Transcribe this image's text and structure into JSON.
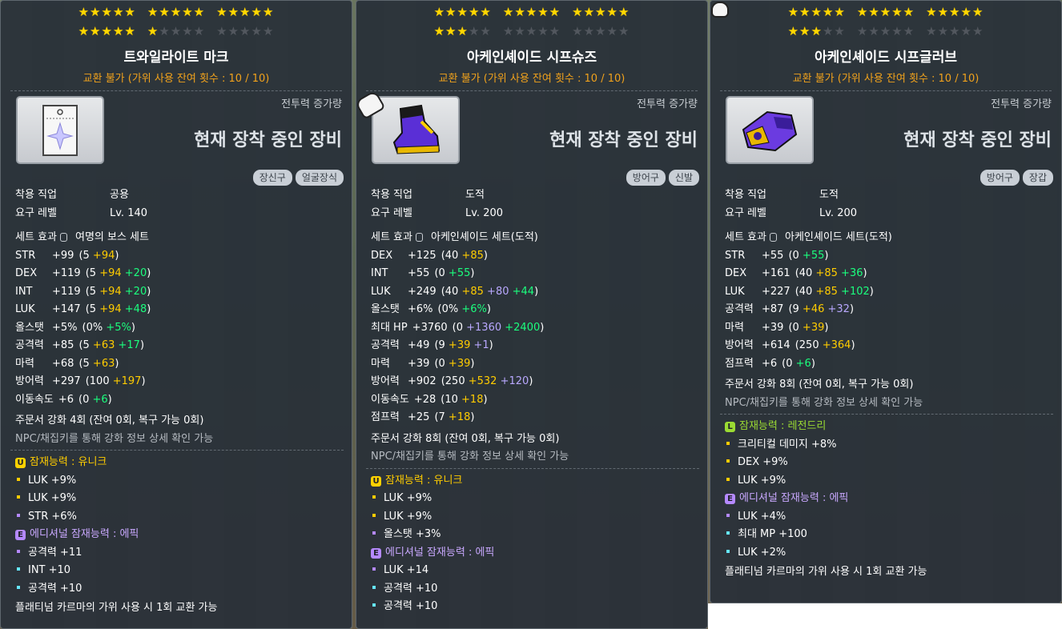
{
  "tooltips": [
    {
      "stars_row1": [
        true,
        true,
        true,
        true,
        true,
        true,
        true,
        true,
        true,
        true,
        true,
        true,
        true,
        true,
        true
      ],
      "stars_row2": [
        true,
        true,
        true,
        true,
        true,
        true,
        false,
        false,
        false,
        false,
        false,
        false,
        false,
        false,
        false
      ],
      "name": "트와일라이트 마크",
      "trade": "교환 불가 (가위 사용 잔여 횟수 : 10 / 10)",
      "cp_label": "전투력 증가량",
      "equipped_label": "현재 장착 중인 장비",
      "icon": "twilight-mark-icon",
      "tags": [
        "장신구",
        "얼굴장식"
      ],
      "job_label": "착용 직업",
      "job": "공용",
      "level_label": "요구 레벨",
      "level": "Lv. 140",
      "set_label": "세트 효과",
      "set_name": "여명의 보스 세트",
      "stats": [
        {
          "name": "STR",
          "total": "+99",
          "parts": [
            {
              "t": "(5 ",
              "c": ""
            },
            {
              "t": "+94",
              "c": "y"
            },
            {
              "t": ")",
              "c": ""
            }
          ]
        },
        {
          "name": "DEX",
          "total": "+119",
          "parts": [
            {
              "t": "(5 ",
              "c": ""
            },
            {
              "t": "+94",
              "c": "y"
            },
            {
              "t": " ",
              "c": ""
            },
            {
              "t": "+20",
              "c": "g"
            },
            {
              "t": ")",
              "c": ""
            }
          ]
        },
        {
          "name": "INT",
          "total": "+119",
          "parts": [
            {
              "t": "(5 ",
              "c": ""
            },
            {
              "t": "+94",
              "c": "y"
            },
            {
              "t": " ",
              "c": ""
            },
            {
              "t": "+20",
              "c": "g"
            },
            {
              "t": ")",
              "c": ""
            }
          ]
        },
        {
          "name": "LUK",
          "total": "+147",
          "parts": [
            {
              "t": "(5 ",
              "c": ""
            },
            {
              "t": "+94",
              "c": "y"
            },
            {
              "t": " ",
              "c": ""
            },
            {
              "t": "+48",
              "c": "g"
            },
            {
              "t": ")",
              "c": ""
            }
          ]
        },
        {
          "name": "올스탯",
          "total": "+5%",
          "parts": [
            {
              "t": "(0% ",
              "c": ""
            },
            {
              "t": "+5%",
              "c": "g"
            },
            {
              "t": ")",
              "c": ""
            }
          ]
        },
        {
          "name": "공격력",
          "total": "+85",
          "parts": [
            {
              "t": "(5 ",
              "c": ""
            },
            {
              "t": "+63",
              "c": "y"
            },
            {
              "t": " ",
              "c": ""
            },
            {
              "t": "+17",
              "c": "g"
            },
            {
              "t": ")",
              "c": ""
            }
          ]
        },
        {
          "name": "마력",
          "total": "+68",
          "parts": [
            {
              "t": "(5 ",
              "c": ""
            },
            {
              "t": "+63",
              "c": "y"
            },
            {
              "t": ")",
              "c": ""
            }
          ]
        },
        {
          "name": "방어력",
          "total": "+297",
          "parts": [
            {
              "t": "(100 ",
              "c": ""
            },
            {
              "t": "+197",
              "c": "y"
            },
            {
              "t": ")",
              "c": ""
            }
          ]
        },
        {
          "name": "이동속도",
          "total": "+6",
          "parts": [
            {
              "t": "(0 ",
              "c": ""
            },
            {
              "t": "+6",
              "c": "g"
            },
            {
              "t": ")",
              "c": ""
            }
          ]
        }
      ],
      "enhance": "주문서 강화 4회 (잔여 0회, 복구 가능 0회)",
      "enhance_hint": "NPC/채집키를 통해 강화 정보 상세 확인 가능",
      "potential": {
        "badge": "U",
        "grade": "u",
        "title": "잠재능력 : 유니크",
        "lines": [
          "LUK +9%",
          "LUK +9%",
          "STR +6%"
        ],
        "colors": [
          "u",
          "u",
          "e"
        ]
      },
      "additional": {
        "badge": "E",
        "grade": "e",
        "title": "에디셔널 잠재능력 : 에픽",
        "lines": [
          "공격력 +11",
          "INT +10",
          "공격력 +10"
        ],
        "colors": [
          "e",
          "c",
          "c"
        ]
      },
      "footer": "플래티넘 카르마의 가위 사용 시 1회 교환 가능"
    },
    {
      "stars_row1": [
        true,
        true,
        true,
        true,
        true,
        true,
        true,
        true,
        true,
        true,
        true,
        true,
        true,
        true,
        true
      ],
      "stars_row2": [
        true,
        true,
        true,
        false,
        false,
        false,
        false,
        false,
        false,
        false,
        false,
        false,
        false,
        false,
        false
      ],
      "name": "아케인셰이드 시프슈즈",
      "trade": "교환 불가 (가위 사용 잔여 횟수 : 10 / 10)",
      "cp_label": "전투력 증가량",
      "equipped_label": "현재 장착 중인 장비",
      "icon": "arcane-shoes-icon",
      "tags": [
        "방어구",
        "신발"
      ],
      "job_label": "착용 직업",
      "job": "도적",
      "level_label": "요구 레벨",
      "level": "Lv. 200",
      "set_label": "세트 효과",
      "set_name": "아케인셰이드 세트(도적)",
      "stats": [
        {
          "name": "DEX",
          "total": "+125",
          "parts": [
            {
              "t": "(40 ",
              "c": ""
            },
            {
              "t": "+85",
              "c": "y"
            },
            {
              "t": ")",
              "c": ""
            }
          ]
        },
        {
          "name": "INT",
          "total": "+55",
          "parts": [
            {
              "t": "(0 ",
              "c": ""
            },
            {
              "t": "+55",
              "c": "g"
            },
            {
              "t": ")",
              "c": ""
            }
          ]
        },
        {
          "name": "LUK",
          "total": "+249",
          "parts": [
            {
              "t": "(40 ",
              "c": ""
            },
            {
              "t": "+85",
              "c": "y"
            },
            {
              "t": " ",
              "c": ""
            },
            {
              "t": "+80",
              "c": "p"
            },
            {
              "t": " ",
              "c": ""
            },
            {
              "t": "+44",
              "c": "g"
            },
            {
              "t": ")",
              "c": ""
            }
          ]
        },
        {
          "name": "올스탯",
          "total": "+6%",
          "parts": [
            {
              "t": "(0% ",
              "c": ""
            },
            {
              "t": "+6%",
              "c": "g"
            },
            {
              "t": ")",
              "c": ""
            }
          ]
        },
        {
          "name": "최대 HP",
          "total": "+3760",
          "parts": [
            {
              "t": "(0 ",
              "c": ""
            },
            {
              "t": "+1360",
              "c": "p"
            },
            {
              "t": " ",
              "c": ""
            },
            {
              "t": "+2400",
              "c": "g"
            },
            {
              "t": ")",
              "c": ""
            }
          ]
        },
        {
          "name": "공격력",
          "total": "+49",
          "parts": [
            {
              "t": "(9 ",
              "c": ""
            },
            {
              "t": "+39",
              "c": "y"
            },
            {
              "t": " ",
              "c": ""
            },
            {
              "t": "+1",
              "c": "p"
            },
            {
              "t": ")",
              "c": ""
            }
          ]
        },
        {
          "name": "마력",
          "total": "+39",
          "parts": [
            {
              "t": "(0 ",
              "c": ""
            },
            {
              "t": "+39",
              "c": "y"
            },
            {
              "t": ")",
              "c": ""
            }
          ]
        },
        {
          "name": "방어력",
          "total": "+902",
          "parts": [
            {
              "t": "(250 ",
              "c": ""
            },
            {
              "t": "+532",
              "c": "y"
            },
            {
              "t": " ",
              "c": ""
            },
            {
              "t": "+120",
              "c": "p"
            },
            {
              "t": ")",
              "c": ""
            }
          ]
        },
        {
          "name": "이동속도",
          "total": "+28",
          "parts": [
            {
              "t": "(10 ",
              "c": ""
            },
            {
              "t": "+18",
              "c": "y"
            },
            {
              "t": ")",
              "c": ""
            }
          ]
        },
        {
          "name": "점프력",
          "total": "+25",
          "parts": [
            {
              "t": "(7 ",
              "c": ""
            },
            {
              "t": "+18",
              "c": "y"
            },
            {
              "t": ")",
              "c": ""
            }
          ]
        }
      ],
      "enhance": "주문서 강화 8회 (잔여 0회, 복구 가능 0회)",
      "enhance_hint": "NPC/채집키를 통해 강화 정보 상세 확인 가능",
      "potential": {
        "badge": "U",
        "grade": "u",
        "title": "잠재능력 : 유니크",
        "lines": [
          "LUK +9%",
          "LUK +9%",
          "올스탯 +3%"
        ],
        "colors": [
          "u",
          "u",
          "e"
        ]
      },
      "additional": {
        "badge": "E",
        "grade": "e",
        "title": "에디셔널 잠재능력 : 에픽",
        "lines": [
          "LUK +14",
          "공격력 +10",
          "공격력 +10"
        ],
        "colors": [
          "e",
          "c",
          "c"
        ]
      },
      "footer": ""
    },
    {
      "stars_row1": [
        true,
        true,
        true,
        true,
        true,
        true,
        true,
        true,
        true,
        true,
        true,
        true,
        true,
        true,
        true
      ],
      "stars_row2": [
        true,
        true,
        true,
        false,
        false,
        false,
        false,
        false,
        false,
        false,
        false,
        false,
        false,
        false,
        false
      ],
      "name": "아케인셰이드 시프글러브",
      "trade": "교환 불가 (가위 사용 잔여 횟수 : 10 / 10)",
      "cp_label": "전투력 증가량",
      "equipped_label": "현재 장착 중인 장비",
      "icon": "arcane-glove-icon",
      "tags": [
        "방어구",
        "장갑"
      ],
      "job_label": "착용 직업",
      "job": "도적",
      "level_label": "요구 레벨",
      "level": "Lv. 200",
      "set_label": "세트 효과",
      "set_name": "아케인셰이드 세트(도적)",
      "stats": [
        {
          "name": "STR",
          "total": "+55",
          "parts": [
            {
              "t": "(0 ",
              "c": ""
            },
            {
              "t": "+55",
              "c": "g"
            },
            {
              "t": ")",
              "c": ""
            }
          ]
        },
        {
          "name": "DEX",
          "total": "+161",
          "parts": [
            {
              "t": "(40 ",
              "c": ""
            },
            {
              "t": "+85",
              "c": "y"
            },
            {
              "t": " ",
              "c": ""
            },
            {
              "t": "+36",
              "c": "g"
            },
            {
              "t": ")",
              "c": ""
            }
          ]
        },
        {
          "name": "LUK",
          "total": "+227",
          "parts": [
            {
              "t": "(40 ",
              "c": ""
            },
            {
              "t": "+85",
              "c": "y"
            },
            {
              "t": " ",
              "c": ""
            },
            {
              "t": "+102",
              "c": "g"
            },
            {
              "t": ")",
              "c": ""
            }
          ]
        },
        {
          "name": "공격력",
          "total": "+87",
          "parts": [
            {
              "t": "(9 ",
              "c": ""
            },
            {
              "t": "+46",
              "c": "y"
            },
            {
              "t": " ",
              "c": ""
            },
            {
              "t": "+32",
              "c": "p"
            },
            {
              "t": ")",
              "c": ""
            }
          ]
        },
        {
          "name": "마력",
          "total": "+39",
          "parts": [
            {
              "t": "(0 ",
              "c": ""
            },
            {
              "t": "+39",
              "c": "y"
            },
            {
              "t": ")",
              "c": ""
            }
          ]
        },
        {
          "name": "방어력",
          "total": "+614",
          "parts": [
            {
              "t": "(250 ",
              "c": ""
            },
            {
              "t": "+364",
              "c": "y"
            },
            {
              "t": ")",
              "c": ""
            }
          ]
        },
        {
          "name": "점프력",
          "total": "+6",
          "parts": [
            {
              "t": "(0 ",
              "c": ""
            },
            {
              "t": "+6",
              "c": "g"
            },
            {
              "t": ")",
              "c": ""
            }
          ]
        }
      ],
      "enhance": "주문서 강화 8회 (잔여 0회, 복구 가능 0회)",
      "enhance_hint": "NPC/채집키를 통해 강화 정보 상세 확인 가능",
      "potential": {
        "badge": "L",
        "grade": "l",
        "title": "잠재능력 : 레전드리",
        "lines": [
          "크리티컬 데미지 +8%",
          "DEX +9%",
          "LUK +9%"
        ],
        "colors": [
          "l",
          "l",
          "l"
        ]
      },
      "additional": {
        "badge": "E",
        "grade": "e",
        "title": "에디셔널 잠재능력 : 에픽",
        "lines": [
          "LUK +4%",
          "최대 MP +100",
          "LUK +2%"
        ],
        "colors": [
          "e",
          "c",
          "c"
        ]
      },
      "footer": "플래티넘 카르마의 가위 사용 시 1회 교환 가능"
    }
  ]
}
